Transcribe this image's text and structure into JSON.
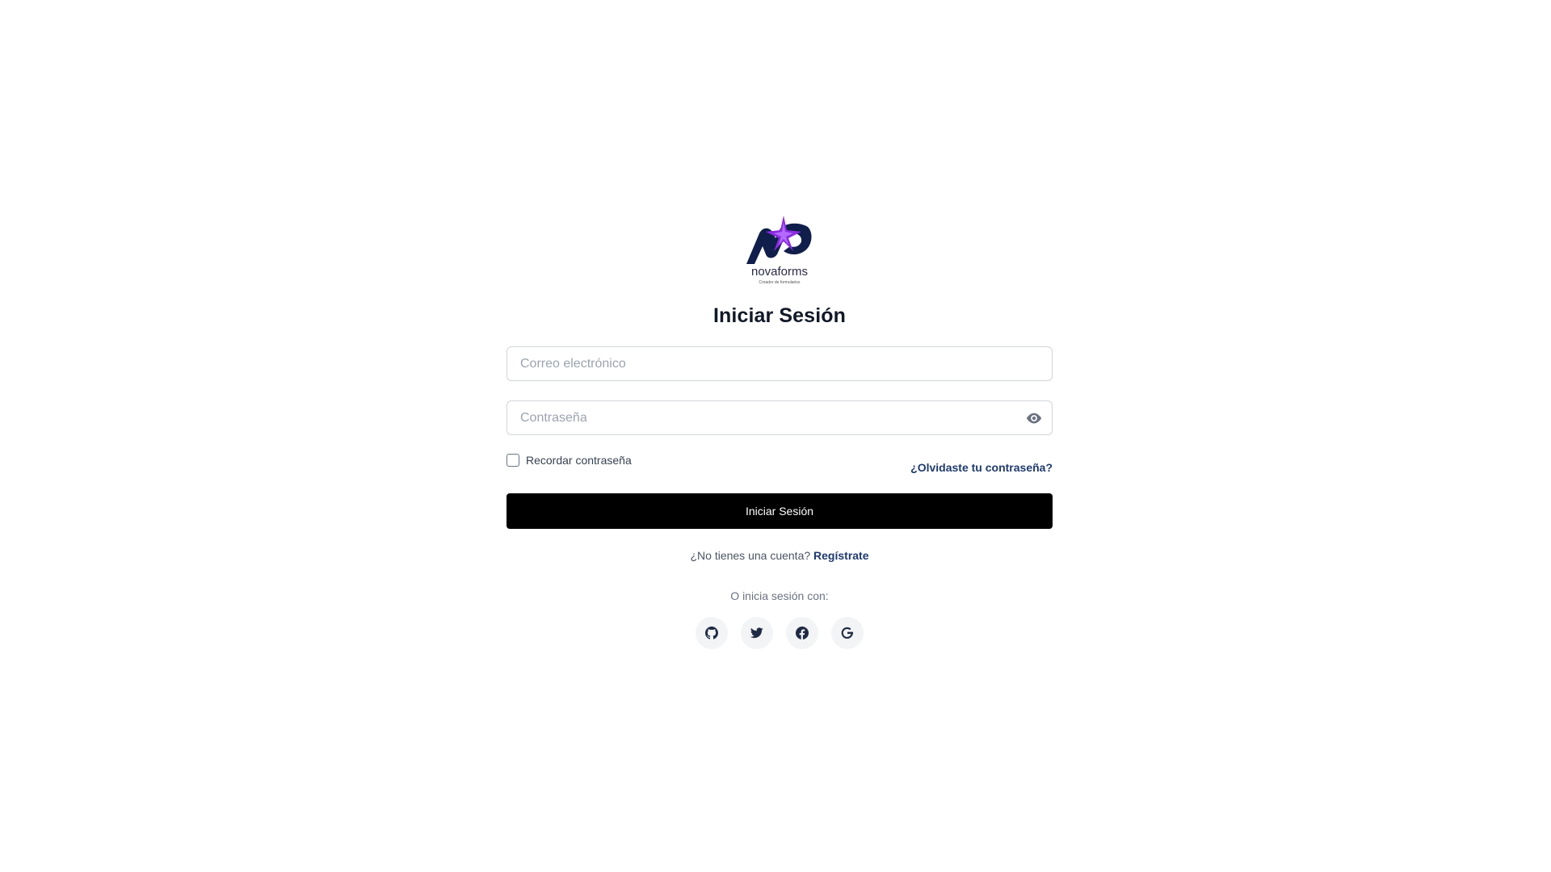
{
  "logo": {
    "brand": "novaforms",
    "tagline": "Creador de formularios",
    "colors": {
      "navy": "#0f1e4a",
      "star": "#8b2be2",
      "star_light": "#b36bff"
    }
  },
  "title": "Iniciar Sesión",
  "email": {
    "placeholder": "Correo electrónico",
    "value": ""
  },
  "password": {
    "placeholder": "Contraseña",
    "value": "",
    "toggle_icon": "eye-icon"
  },
  "remember": {
    "label": "Recordar contraseña",
    "checked": false
  },
  "forgot_link": "¿Olvidaste tu contraseña?",
  "submit_label": "Iniciar Sesión",
  "signup": {
    "prompt": "¿No tienes una cuenta?",
    "link": "Regístrate"
  },
  "alt_login_label": "O inicia sesión con:",
  "social": [
    {
      "name": "github",
      "icon": "github-icon"
    },
    {
      "name": "twitter",
      "icon": "twitter-icon"
    },
    {
      "name": "facebook",
      "icon": "facebook-icon"
    },
    {
      "name": "google",
      "icon": "google-icon"
    }
  ],
  "colors": {
    "button_bg": "#000000",
    "link": "#1e3a6e",
    "input_border": "#d1d5db",
    "social_bg": "#f3f4f6",
    "icon": "#1f2a44"
  }
}
